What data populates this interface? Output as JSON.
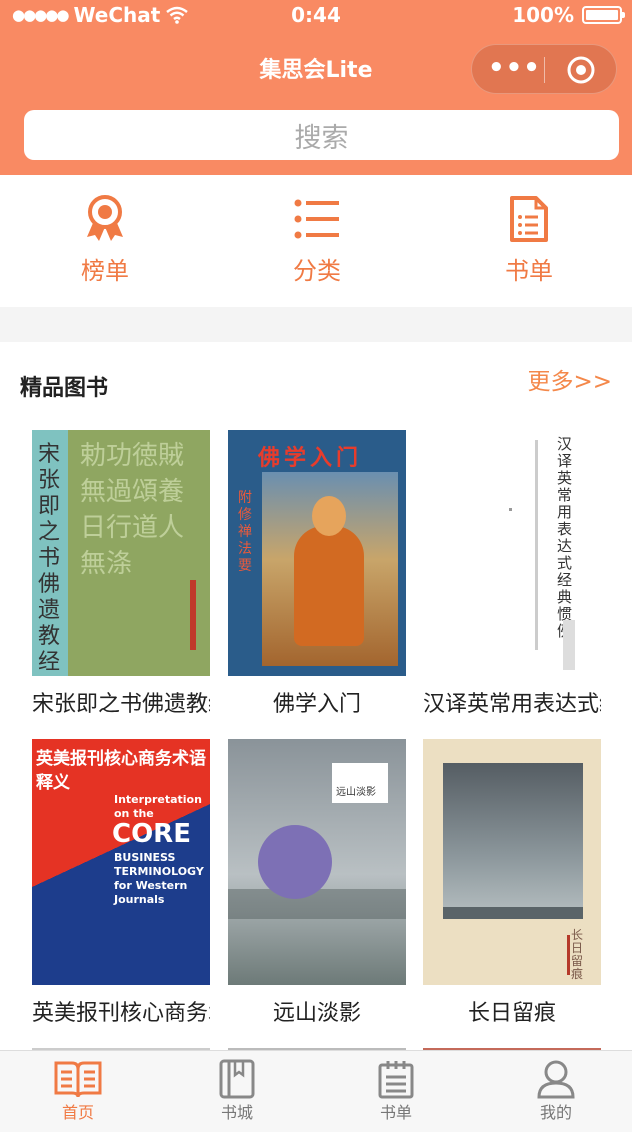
{
  "status_bar": {
    "carrier": "WeChat",
    "time": "0:44",
    "battery": "100%"
  },
  "header": {
    "title": "集思会Lite",
    "menu_icon": "more-dots-icon",
    "close_icon": "target-icon"
  },
  "search": {
    "placeholder": "搜索"
  },
  "quick_nav": [
    {
      "label": "榜单",
      "icon": "award-ribbon-icon"
    },
    {
      "label": "分类",
      "icon": "list-icon"
    },
    {
      "label": "书单",
      "icon": "document-icon"
    }
  ],
  "section": {
    "title": "精品图书",
    "more": "更多>>"
  },
  "books": [
    {
      "title": "宋张即之书佛遗教经",
      "cover_text": "宋张即之书佛遗教经"
    },
    {
      "title": "佛学入门",
      "cover_text": "佛学入门"
    },
    {
      "title": "汉译英常用表达式经典惯例",
      "cover_text": "汉译英常用表达式经典惯例"
    },
    {
      "title": "英美报刊核心商务术语释义",
      "cover_text": "英美报刊核心商务术语释义"
    },
    {
      "title": "远山淡影",
      "cover_text": "远山淡影"
    },
    {
      "title": "长日留痕",
      "cover_text": "长日留痕"
    }
  ],
  "tabs": [
    {
      "label": "首页",
      "icon": "open-book-icon",
      "active": true
    },
    {
      "label": "书城",
      "icon": "book-icon",
      "active": false
    },
    {
      "label": "书单",
      "icon": "notepad-icon",
      "active": false
    },
    {
      "label": "我的",
      "icon": "user-icon",
      "active": false
    }
  ],
  "colors": {
    "brand": "#f98a63",
    "accent": "#f07a44"
  }
}
